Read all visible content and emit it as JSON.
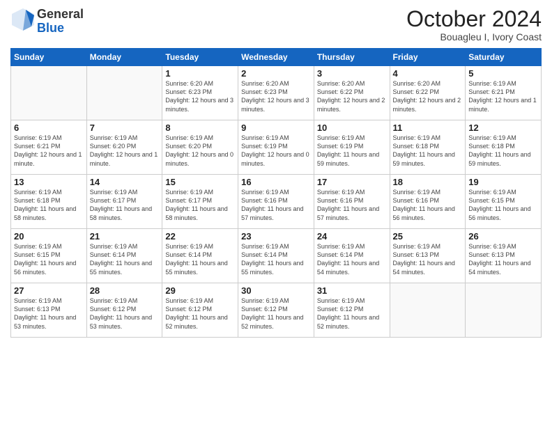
{
  "header": {
    "logo_general": "General",
    "logo_blue": "Blue",
    "month_year": "October 2024",
    "location": "Bouagleu I, Ivory Coast"
  },
  "days_of_week": [
    "Sunday",
    "Monday",
    "Tuesday",
    "Wednesday",
    "Thursday",
    "Friday",
    "Saturday"
  ],
  "weeks": [
    [
      {
        "day": "",
        "detail": ""
      },
      {
        "day": "",
        "detail": ""
      },
      {
        "day": "1",
        "detail": "Sunrise: 6:20 AM\nSunset: 6:23 PM\nDaylight: 12 hours and 3 minutes."
      },
      {
        "day": "2",
        "detail": "Sunrise: 6:20 AM\nSunset: 6:23 PM\nDaylight: 12 hours and 3 minutes."
      },
      {
        "day": "3",
        "detail": "Sunrise: 6:20 AM\nSunset: 6:22 PM\nDaylight: 12 hours and 2 minutes."
      },
      {
        "day": "4",
        "detail": "Sunrise: 6:20 AM\nSunset: 6:22 PM\nDaylight: 12 hours and 2 minutes."
      },
      {
        "day": "5",
        "detail": "Sunrise: 6:19 AM\nSunset: 6:21 PM\nDaylight: 12 hours and 1 minute."
      }
    ],
    [
      {
        "day": "6",
        "detail": "Sunrise: 6:19 AM\nSunset: 6:21 PM\nDaylight: 12 hours and 1 minute."
      },
      {
        "day": "7",
        "detail": "Sunrise: 6:19 AM\nSunset: 6:20 PM\nDaylight: 12 hours and 1 minute."
      },
      {
        "day": "8",
        "detail": "Sunrise: 6:19 AM\nSunset: 6:20 PM\nDaylight: 12 hours and 0 minutes."
      },
      {
        "day": "9",
        "detail": "Sunrise: 6:19 AM\nSunset: 6:19 PM\nDaylight: 12 hours and 0 minutes."
      },
      {
        "day": "10",
        "detail": "Sunrise: 6:19 AM\nSunset: 6:19 PM\nDaylight: 11 hours and 59 minutes."
      },
      {
        "day": "11",
        "detail": "Sunrise: 6:19 AM\nSunset: 6:18 PM\nDaylight: 11 hours and 59 minutes."
      },
      {
        "day": "12",
        "detail": "Sunrise: 6:19 AM\nSunset: 6:18 PM\nDaylight: 11 hours and 59 minutes."
      }
    ],
    [
      {
        "day": "13",
        "detail": "Sunrise: 6:19 AM\nSunset: 6:18 PM\nDaylight: 11 hours and 58 minutes."
      },
      {
        "day": "14",
        "detail": "Sunrise: 6:19 AM\nSunset: 6:17 PM\nDaylight: 11 hours and 58 minutes."
      },
      {
        "day": "15",
        "detail": "Sunrise: 6:19 AM\nSunset: 6:17 PM\nDaylight: 11 hours and 58 minutes."
      },
      {
        "day": "16",
        "detail": "Sunrise: 6:19 AM\nSunset: 6:16 PM\nDaylight: 11 hours and 57 minutes."
      },
      {
        "day": "17",
        "detail": "Sunrise: 6:19 AM\nSunset: 6:16 PM\nDaylight: 11 hours and 57 minutes."
      },
      {
        "day": "18",
        "detail": "Sunrise: 6:19 AM\nSunset: 6:16 PM\nDaylight: 11 hours and 56 minutes."
      },
      {
        "day": "19",
        "detail": "Sunrise: 6:19 AM\nSunset: 6:15 PM\nDaylight: 11 hours and 56 minutes."
      }
    ],
    [
      {
        "day": "20",
        "detail": "Sunrise: 6:19 AM\nSunset: 6:15 PM\nDaylight: 11 hours and 56 minutes."
      },
      {
        "day": "21",
        "detail": "Sunrise: 6:19 AM\nSunset: 6:14 PM\nDaylight: 11 hours and 55 minutes."
      },
      {
        "day": "22",
        "detail": "Sunrise: 6:19 AM\nSunset: 6:14 PM\nDaylight: 11 hours and 55 minutes."
      },
      {
        "day": "23",
        "detail": "Sunrise: 6:19 AM\nSunset: 6:14 PM\nDaylight: 11 hours and 55 minutes."
      },
      {
        "day": "24",
        "detail": "Sunrise: 6:19 AM\nSunset: 6:14 PM\nDaylight: 11 hours and 54 minutes."
      },
      {
        "day": "25",
        "detail": "Sunrise: 6:19 AM\nSunset: 6:13 PM\nDaylight: 11 hours and 54 minutes."
      },
      {
        "day": "26",
        "detail": "Sunrise: 6:19 AM\nSunset: 6:13 PM\nDaylight: 11 hours and 54 minutes."
      }
    ],
    [
      {
        "day": "27",
        "detail": "Sunrise: 6:19 AM\nSunset: 6:13 PM\nDaylight: 11 hours and 53 minutes."
      },
      {
        "day": "28",
        "detail": "Sunrise: 6:19 AM\nSunset: 6:12 PM\nDaylight: 11 hours and 53 minutes."
      },
      {
        "day": "29",
        "detail": "Sunrise: 6:19 AM\nSunset: 6:12 PM\nDaylight: 11 hours and 52 minutes."
      },
      {
        "day": "30",
        "detail": "Sunrise: 6:19 AM\nSunset: 6:12 PM\nDaylight: 11 hours and 52 minutes."
      },
      {
        "day": "31",
        "detail": "Sunrise: 6:19 AM\nSunset: 6:12 PM\nDaylight: 11 hours and 52 minutes."
      },
      {
        "day": "",
        "detail": ""
      },
      {
        "day": "",
        "detail": ""
      }
    ]
  ]
}
